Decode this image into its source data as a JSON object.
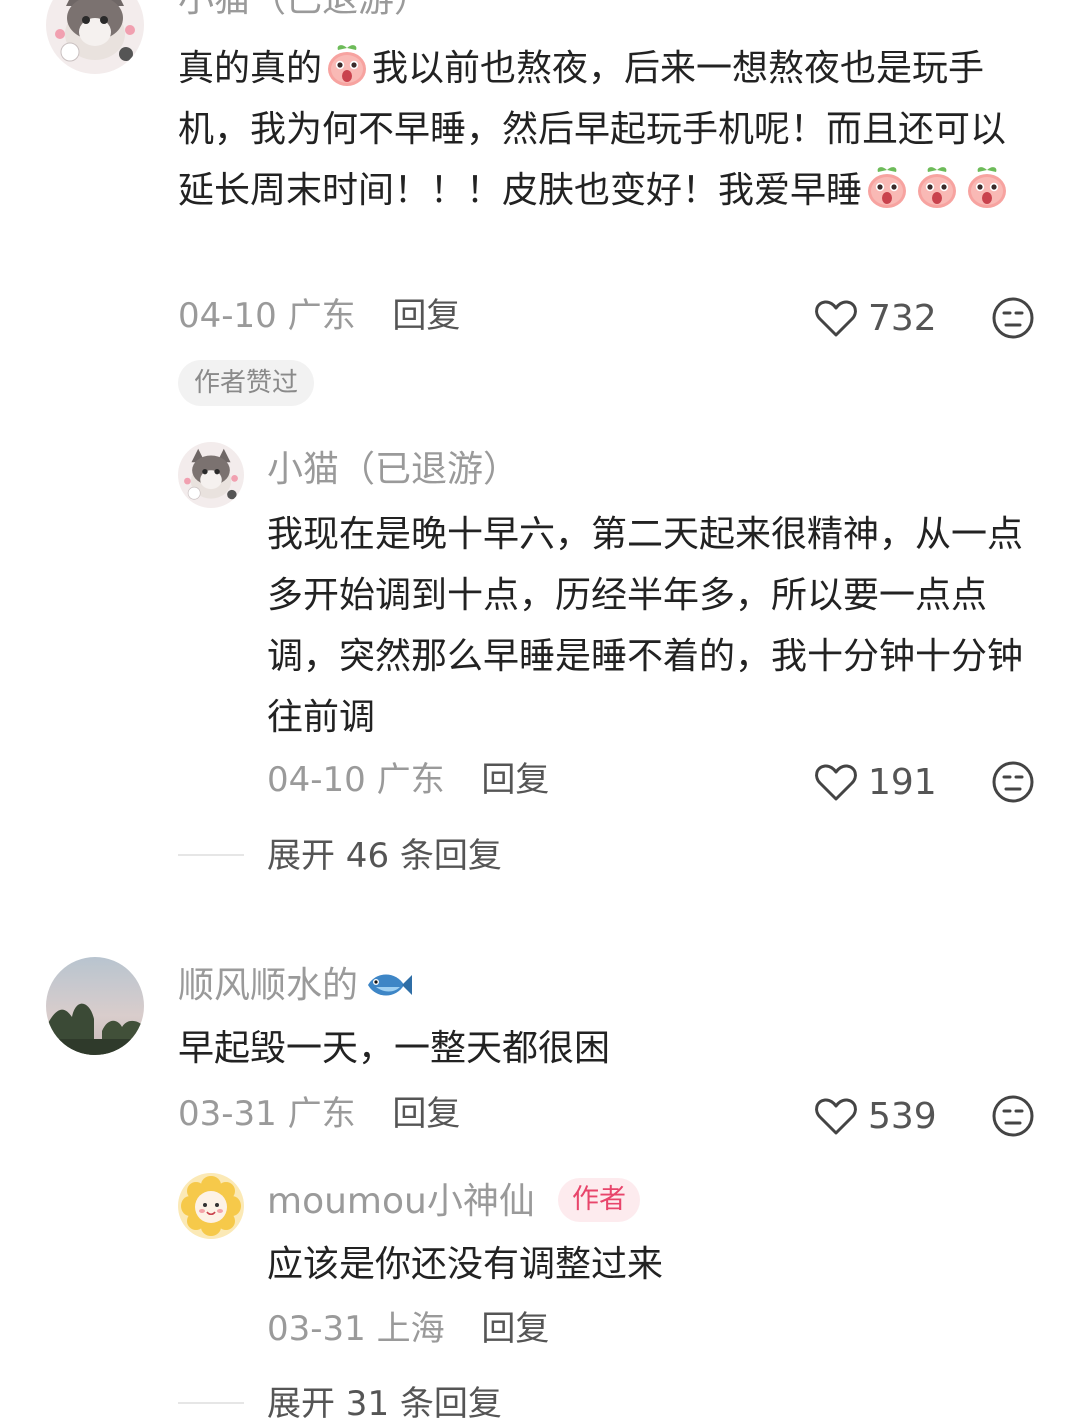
{
  "comments": [
    {
      "username": "小猫（已退游）",
      "text_parts": [
        "真的真的",
        "我以前也熬夜，后来一想熬夜也是玩手机，我为何不早睡，然后早起玩手机呢！而且还可以延长周末时间！！！皮肤也变好！我爱早睡"
      ],
      "date": "04-10",
      "location": "广东",
      "reply_label": "回复",
      "likes": "732",
      "author_liked_badge": "作者赞过",
      "avatar_icon": "cat-avatar",
      "replies": [
        {
          "username": "小猫（已退游）",
          "text": "我现在是晚十早六，第二天起来很精神，从一点多开始调到十点，历经半年多，所以要一点点调，突然那么早睡是睡不着的，我十分钟十分钟往前调",
          "date": "04-10",
          "location": "广东",
          "reply_label": "回复",
          "likes": "191",
          "avatar_icon": "cat-avatar"
        }
      ],
      "expand_label": "展开 46 条回复"
    },
    {
      "username": "顺风顺水的",
      "username_emoji": "fish-icon",
      "text": "早起毁一天，一整天都很困",
      "date": "03-31",
      "location": "广东",
      "reply_label": "回复",
      "likes": "539",
      "avatar_icon": "sunset-trees-avatar",
      "replies": [
        {
          "username": "moumou小神仙",
          "author_tag": "作者",
          "text": "应该是你还没有调整过来",
          "date": "03-31",
          "location": "上海",
          "reply_label": "回复",
          "avatar_icon": "flower-avatar"
        }
      ],
      "expand_label": "展开 31 条回复"
    }
  ],
  "colors": {
    "meta_gray": "#9a9a9a",
    "text_dark": "#222222",
    "author_pink": "#e8456b"
  }
}
